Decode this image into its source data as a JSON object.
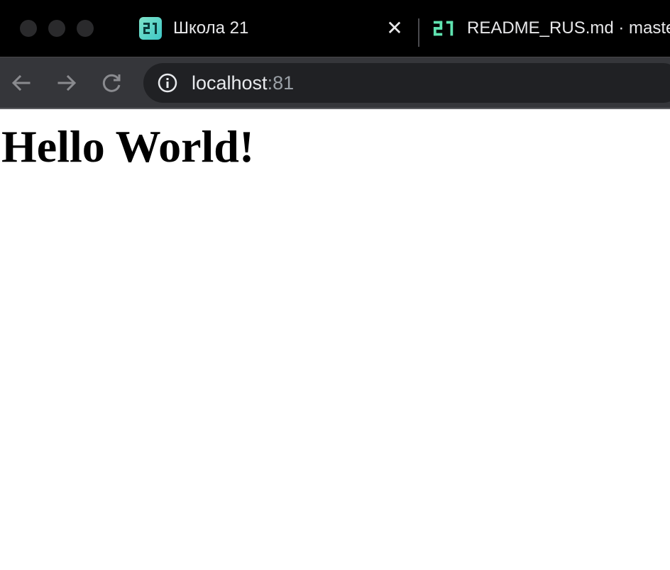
{
  "tabs": [
    {
      "title": "Школа 21",
      "favicon": "school-21-icon",
      "active": true,
      "close_label": "✕"
    },
    {
      "title": "README_RUS.md · maste",
      "favicon": "school-21-icon",
      "active": false
    }
  ],
  "toolbar": {
    "back_icon": "back-arrow-icon",
    "forward_icon": "forward-arrow-icon",
    "reload_icon": "reload-icon"
  },
  "address_bar": {
    "host": "localhost",
    "port": ":81",
    "site_info_icon": "info-icon"
  },
  "page": {
    "heading": "Hello World!"
  },
  "colors": {
    "tabbar_bg": "#000000",
    "toolbar_bg": "#35363a",
    "omnibox_bg": "#202124",
    "favicon_accent": "#5fe3b0"
  }
}
